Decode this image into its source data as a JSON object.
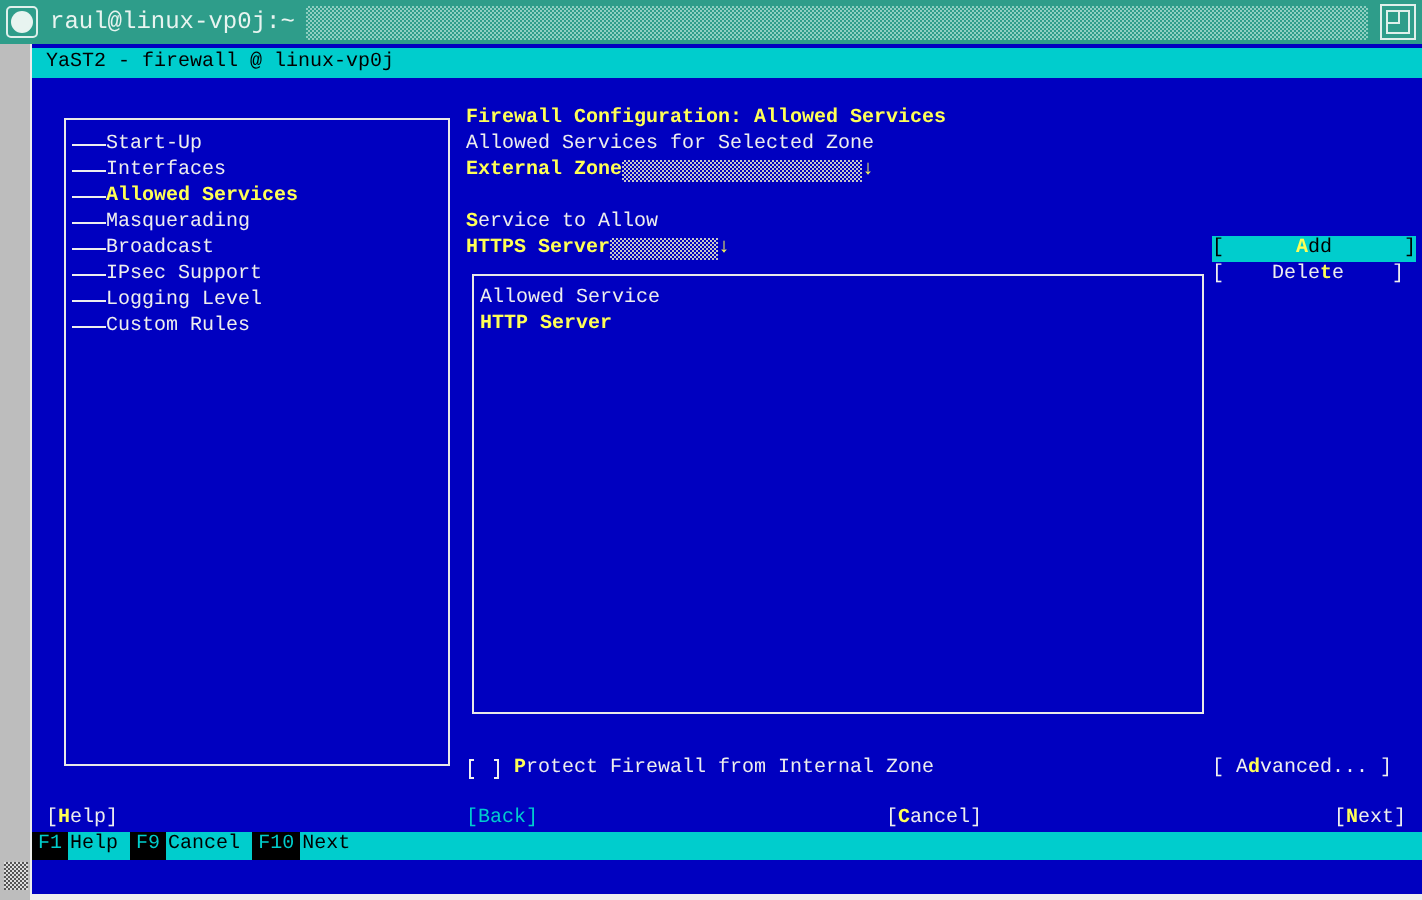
{
  "window": {
    "title": "raul@linux-vp0j:~"
  },
  "dialog": {
    "title": "YaST2 - firewall @ linux-vp0j"
  },
  "tree": {
    "items": [
      {
        "label": "Start-Up",
        "selected": false
      },
      {
        "label": "Interfaces",
        "selected": false
      },
      {
        "label": "Allowed Services",
        "selected": true
      },
      {
        "label": "Masquerading",
        "selected": false
      },
      {
        "label": "Broadcast",
        "selected": false
      },
      {
        "label": "IPsec Support",
        "selected": false
      },
      {
        "label": "Logging Level",
        "selected": false
      },
      {
        "label": "Custom Rules",
        "selected": false
      }
    ]
  },
  "content": {
    "heading": "Firewall Configuration: Allowed Services",
    "zone_label": "Allowed Services for Selected Zone",
    "zone": {
      "value": "External Zone",
      "arrow": "↓"
    },
    "service_label": "**S**ervice to Allow",
    "service": {
      "value": "HTTPS Server",
      "arrow": "↓"
    },
    "add_button": {
      "label": "[      **A**dd      ]",
      "focused": true
    },
    "delete_button": {
      "label": "[    Dele**t**e    ]",
      "focused": false
    },
    "list": {
      "header": "Allowed Service",
      "rows": [
        {
          "name": "HTTP Server",
          "selected": true
        }
      ]
    },
    "protect_checkbox": {
      "label": "**P**rotect Firewall from Internal Zone",
      "checked": false
    },
    "advanced_button": {
      "label": "[ A**d**vanced... ]",
      "focused": false
    }
  },
  "buttons": [
    {
      "label": "[**H**elp]",
      "disabled": false
    },
    {
      "label": "[Back]",
      "disabled": true
    },
    {
      "label": "[**C**ancel]",
      "disabled": false
    },
    {
      "label": "[**N**ext]",
      "disabled": false
    }
  ],
  "function_keys": [
    {
      "key": "F1",
      "label": "Help"
    },
    {
      "key": "F9",
      "label": "Cancel"
    },
    {
      "key": "F10",
      "label": "Next"
    }
  ]
}
